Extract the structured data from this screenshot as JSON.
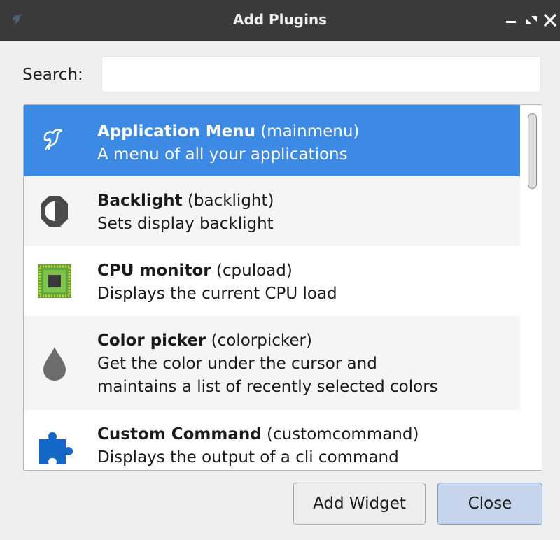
{
  "window": {
    "title": "Add Plugins",
    "controls": [
      "minimize",
      "maximize",
      "close"
    ]
  },
  "search": {
    "label": "Search:",
    "value": "",
    "placeholder": ""
  },
  "plugins": [
    {
      "name": "Application Menu",
      "id": " (mainmenu)",
      "description": "A menu of all your applications",
      "icon": "bird-icon",
      "selected": true
    },
    {
      "name": "Backlight",
      "id": " (backlight)",
      "description": "Sets display backlight",
      "icon": "brightness-icon",
      "selected": false
    },
    {
      "name": "CPU monitor",
      "id": " (cpuload)",
      "description": "Displays the current CPU load",
      "icon": "cpu-chip-icon",
      "selected": false
    },
    {
      "name": "Color picker",
      "id": " (colorpicker)",
      "description": "Get the color under the cursor and",
      "description2": "maintains a list of recently selected colors",
      "icon": "droplet-icon",
      "selected": false
    },
    {
      "name": "Custom Command",
      "id": " (customcommand)",
      "description": "Displays the output of a cli command",
      "icon": "puzzle-piece-icon",
      "selected": false
    }
  ],
  "buttons": {
    "add_widget": "Add Widget",
    "close": "Close"
  },
  "colors": {
    "titlebar": "#3a3a3a",
    "selection": "#3c8ae3",
    "close_button": "#c6d5ec"
  }
}
